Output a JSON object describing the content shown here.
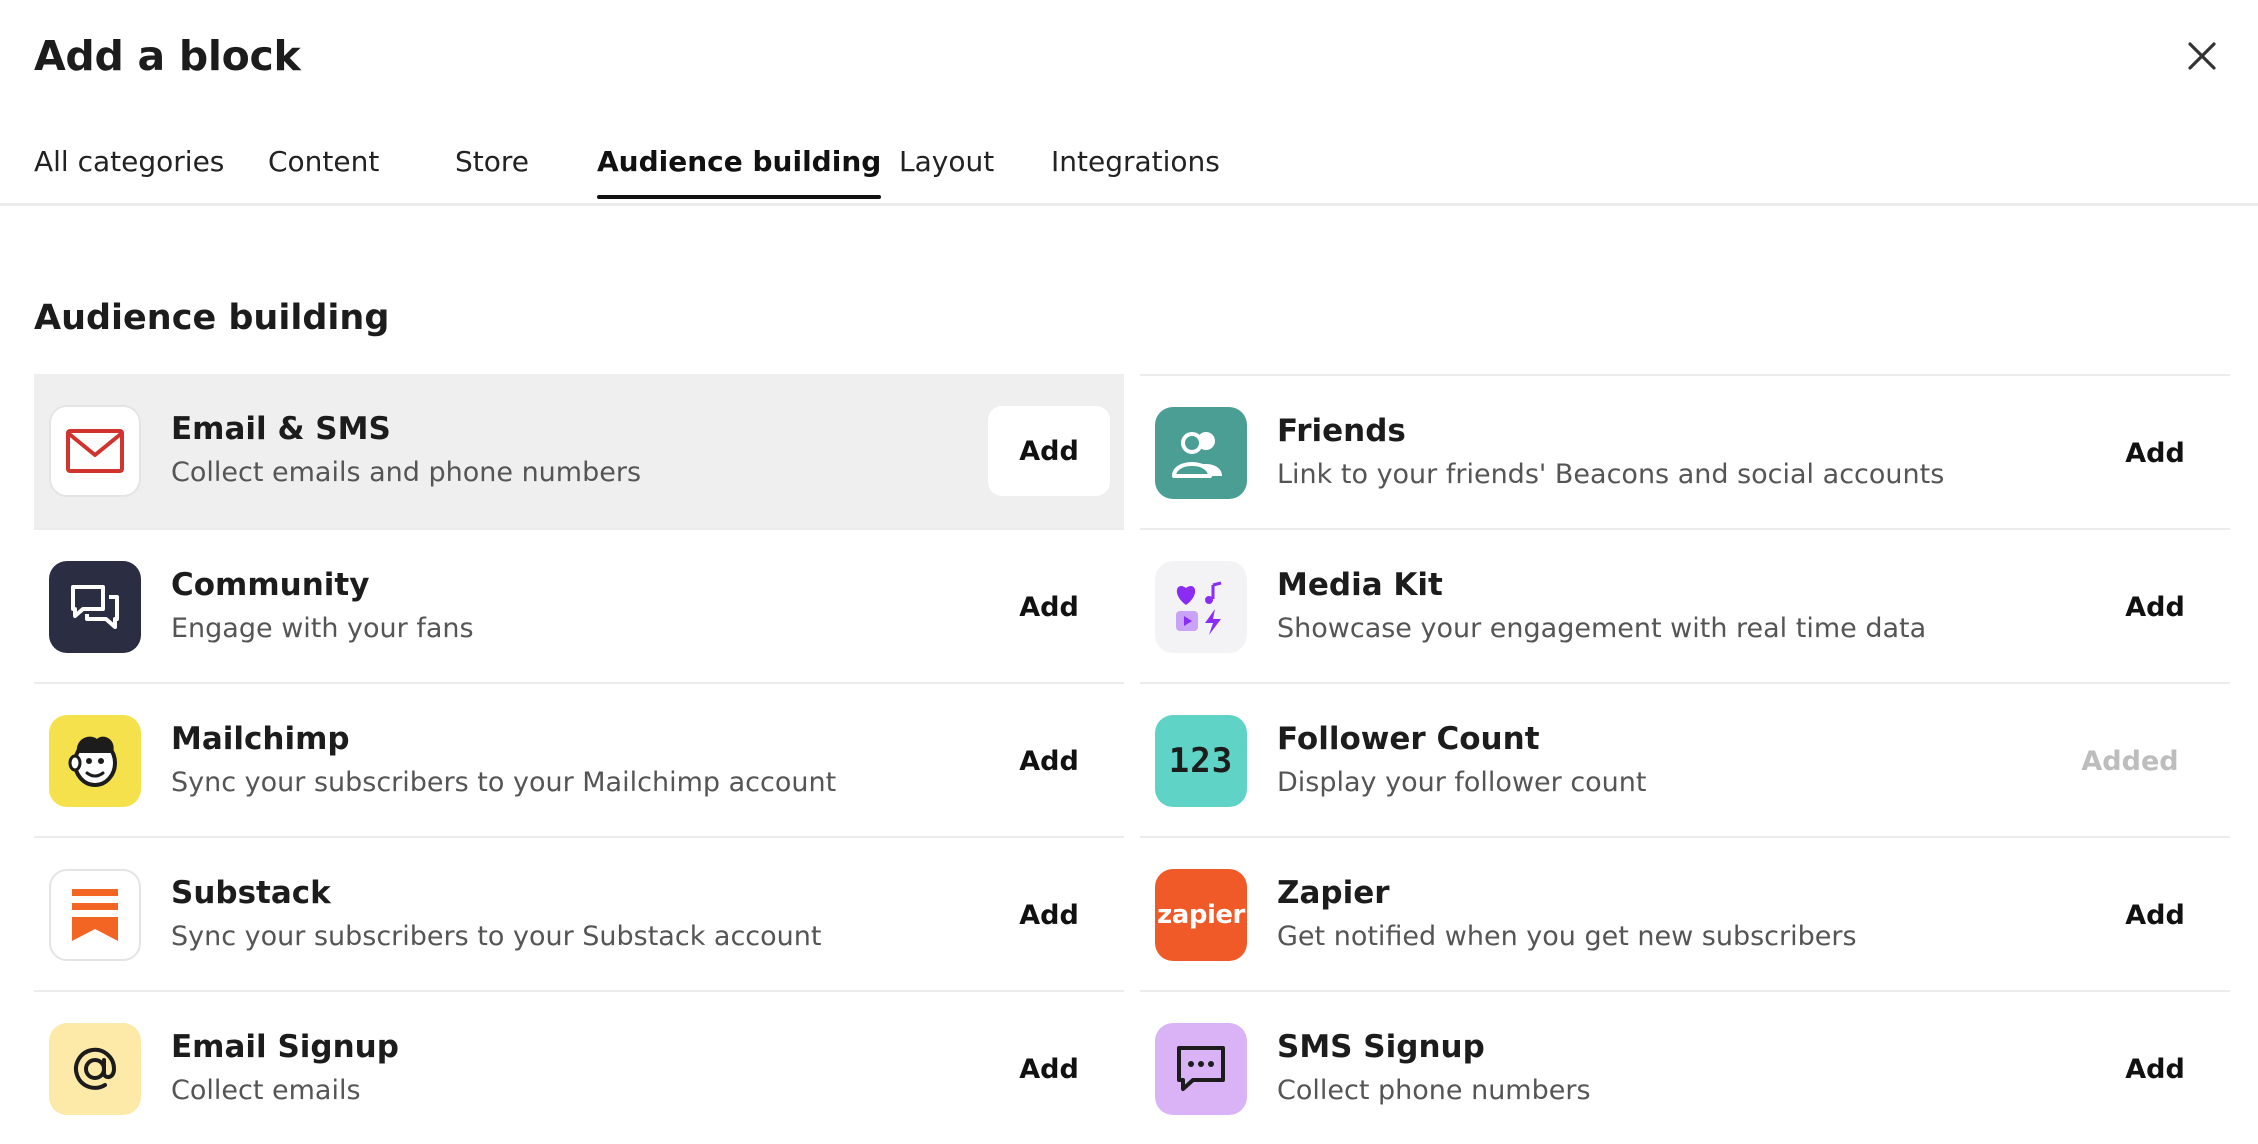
{
  "modal": {
    "title": "Add a block"
  },
  "tabs": [
    {
      "label": "All categories"
    },
    {
      "label": "Content"
    },
    {
      "label": "Store"
    },
    {
      "label": "Audience building",
      "active": true
    },
    {
      "label": "Layout"
    },
    {
      "label": "Integrations"
    }
  ],
  "section": {
    "title": "Audience building"
  },
  "blocks": {
    "left": [
      {
        "name": "Email & SMS",
        "description": "Collect emails and phone numbers",
        "action": "Add",
        "icon": "envelope-icon",
        "icon_bg": "#ffffff",
        "icon_fg": "#d0342c"
      },
      {
        "name": "Community",
        "description": "Engage with your fans",
        "action": "Add",
        "icon": "chat-bubbles-icon",
        "icon_bg": "#2b2d42",
        "icon_fg": "#ffffff"
      },
      {
        "name": "Mailchimp",
        "description": "Sync your subscribers to your Mailchimp account",
        "action": "Add",
        "icon": "mailchimp-icon",
        "icon_bg": "#f5e14b",
        "icon_fg": "#1c1c1c"
      },
      {
        "name": "Substack",
        "description": "Sync your subscribers to your Substack account",
        "action": "Add",
        "icon": "substack-icon",
        "icon_bg": "#ffffff",
        "icon_fg": "#f26522"
      },
      {
        "name": "Email Signup",
        "description": "Collect emails",
        "action": "Add",
        "icon": "at-sign-icon",
        "icon_bg": "#fde9a8",
        "icon_fg": "#1c1c1c"
      }
    ],
    "right": [
      {
        "name": "Friends",
        "description": "Link to your friends' Beacons and social accounts",
        "action": "Add",
        "icon": "friends-icon",
        "icon_bg": "#4a9e94",
        "icon_fg": "#ffffff"
      },
      {
        "name": "Media Kit",
        "description": "Showcase your engagement with real time data",
        "action": "Add",
        "icon": "media-kit-icon",
        "icon_bg": "#f3f3f5",
        "icon_fg": "#8b2cf5"
      },
      {
        "name": "Follower Count",
        "description": "Display your follower count",
        "action": "Added",
        "icon": "number-123-icon",
        "icon_bg": "#5ed3c6",
        "icon_fg": "#1c1c1c",
        "icon_text": "123"
      },
      {
        "name": "Zapier",
        "description": "Get notified when you get new subscribers",
        "action": "Add",
        "icon": "zapier-icon",
        "icon_bg": "#f05a28",
        "icon_fg": "#ffffff",
        "icon_text": "zapier"
      },
      {
        "name": "SMS Signup",
        "description": "Collect phone numbers",
        "action": "Add",
        "icon": "sms-bubble-icon",
        "icon_bg": "#d9b3f5",
        "icon_fg": "#1c1c1c"
      }
    ]
  }
}
